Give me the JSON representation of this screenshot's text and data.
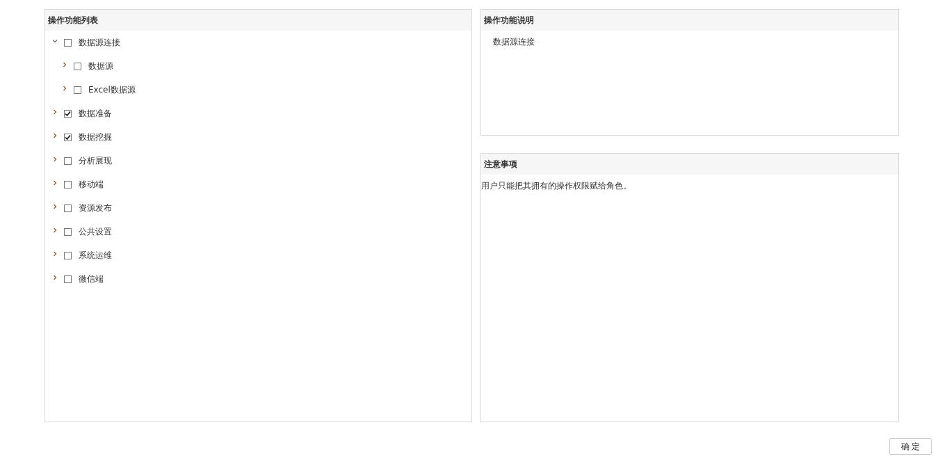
{
  "function_list": {
    "title": "操作功能列表",
    "items": [
      {
        "label": "数据源连接",
        "checked": false,
        "expanded": true,
        "children": [
          {
            "label": "数据源",
            "checked": false,
            "expanded": false
          },
          {
            "label": "Excel数据源",
            "checked": false,
            "expanded": false
          }
        ]
      },
      {
        "label": "数据准备",
        "checked": true,
        "expanded": false
      },
      {
        "label": "数据挖掘",
        "checked": true,
        "expanded": false
      },
      {
        "label": "分析展现",
        "checked": false,
        "expanded": false
      },
      {
        "label": "移动端",
        "checked": false,
        "expanded": false
      },
      {
        "label": "资源发布",
        "checked": false,
        "expanded": false
      },
      {
        "label": "公共设置",
        "checked": false,
        "expanded": false
      },
      {
        "label": "系统运维",
        "checked": false,
        "expanded": false
      },
      {
        "label": "微信端",
        "checked": false,
        "expanded": false
      }
    ]
  },
  "description": {
    "title": "操作功能说明",
    "text": "数据源连接"
  },
  "notes": {
    "title": "注意事项",
    "text": "用户只能把其拥有的操作权限赋给角色。"
  },
  "buttons": [
    "确 定"
  ]
}
